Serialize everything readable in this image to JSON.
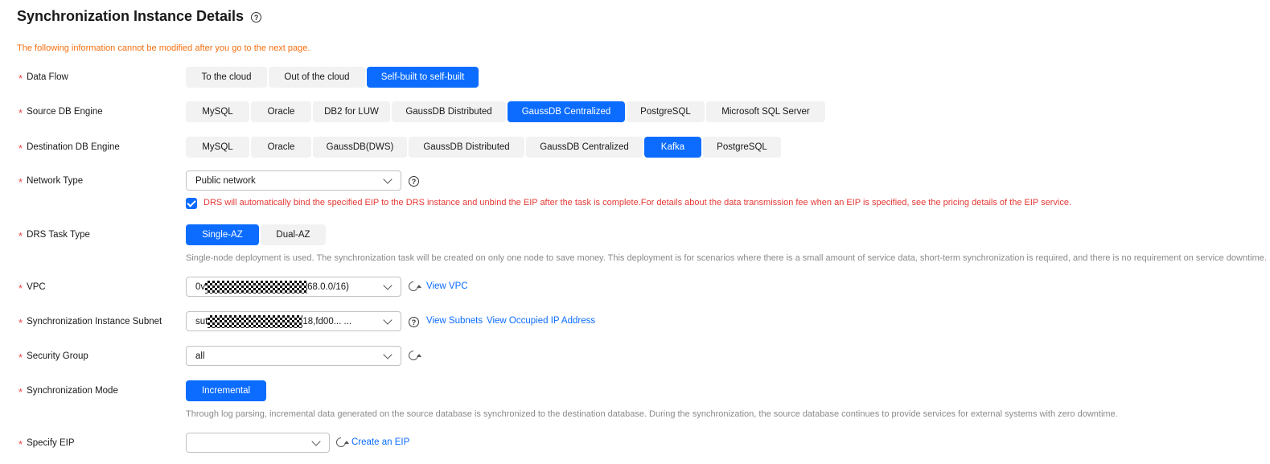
{
  "page": {
    "title": "Synchronization Instance Details",
    "notice": "The following information cannot be modified after you go to the next page."
  },
  "data_flow": {
    "label": "Data Flow",
    "options": [
      "To the cloud",
      "Out of the cloud",
      "Self-built to self-built"
    ],
    "selected": "Self-built to self-built"
  },
  "source_engine": {
    "label": "Source DB Engine",
    "options": [
      "MySQL",
      "Oracle",
      "DB2 for LUW",
      "GaussDB Distributed",
      "GaussDB Centralized",
      "PostgreSQL",
      "Microsoft SQL Server"
    ],
    "selected": "GaussDB Centralized"
  },
  "dest_engine": {
    "label": "Destination DB Engine",
    "options": [
      "MySQL",
      "Oracle",
      "GaussDB(DWS)",
      "GaussDB Distributed",
      "GaussDB Centralized",
      "Kafka",
      "PostgreSQL"
    ],
    "selected": "Kafka"
  },
  "network_type": {
    "label": "Network Type",
    "value": "Public network",
    "checkbox_checked": true,
    "warning": "DRS will automatically bind the specified EIP to the DRS instance and unbind the EIP after the task is complete.For details about the data transmission fee when an EIP is specified, see the pricing details of the EIP service."
  },
  "task_type": {
    "label": "DRS Task Type",
    "options": [
      "Single-AZ",
      "Dual-AZ"
    ],
    "selected": "Single-AZ",
    "hint": "Single-node deployment is used. The synchronization task will be created on only one node to save money. This deployment is for scenarios where there is a small amount of service data, short-term synchronization is required, and there is no requirement on service downtime."
  },
  "vpc": {
    "label": "VPC",
    "value_prefix": "0v",
    "value_suffix": "68.0.0/16)",
    "link": "View VPC"
  },
  "subnet": {
    "label": "Synchronization Instance Subnet",
    "value_prefix": "sut",
    "value_suffix": "18,fd00... ...",
    "link_subnets": "View Subnets",
    "link_occupied": "View Occupied IP Address"
  },
  "security_group": {
    "label": "Security Group",
    "value": "all"
  },
  "sync_mode": {
    "label": "Synchronization Mode",
    "options": [
      "Incremental"
    ],
    "selected": "Incremental",
    "hint": "Through log parsing, incremental data generated on the source database is synchronized to the destination database. During the synchronization, the source database continues to provide services for external systems with zero downtime."
  },
  "eip": {
    "label": "Specify EIP",
    "value": "",
    "link": "Create an EIP"
  },
  "colors": {
    "accent": "#0b6cff",
    "warning": "#e53935",
    "notice": "#f66f0f",
    "required": "#e54545"
  }
}
